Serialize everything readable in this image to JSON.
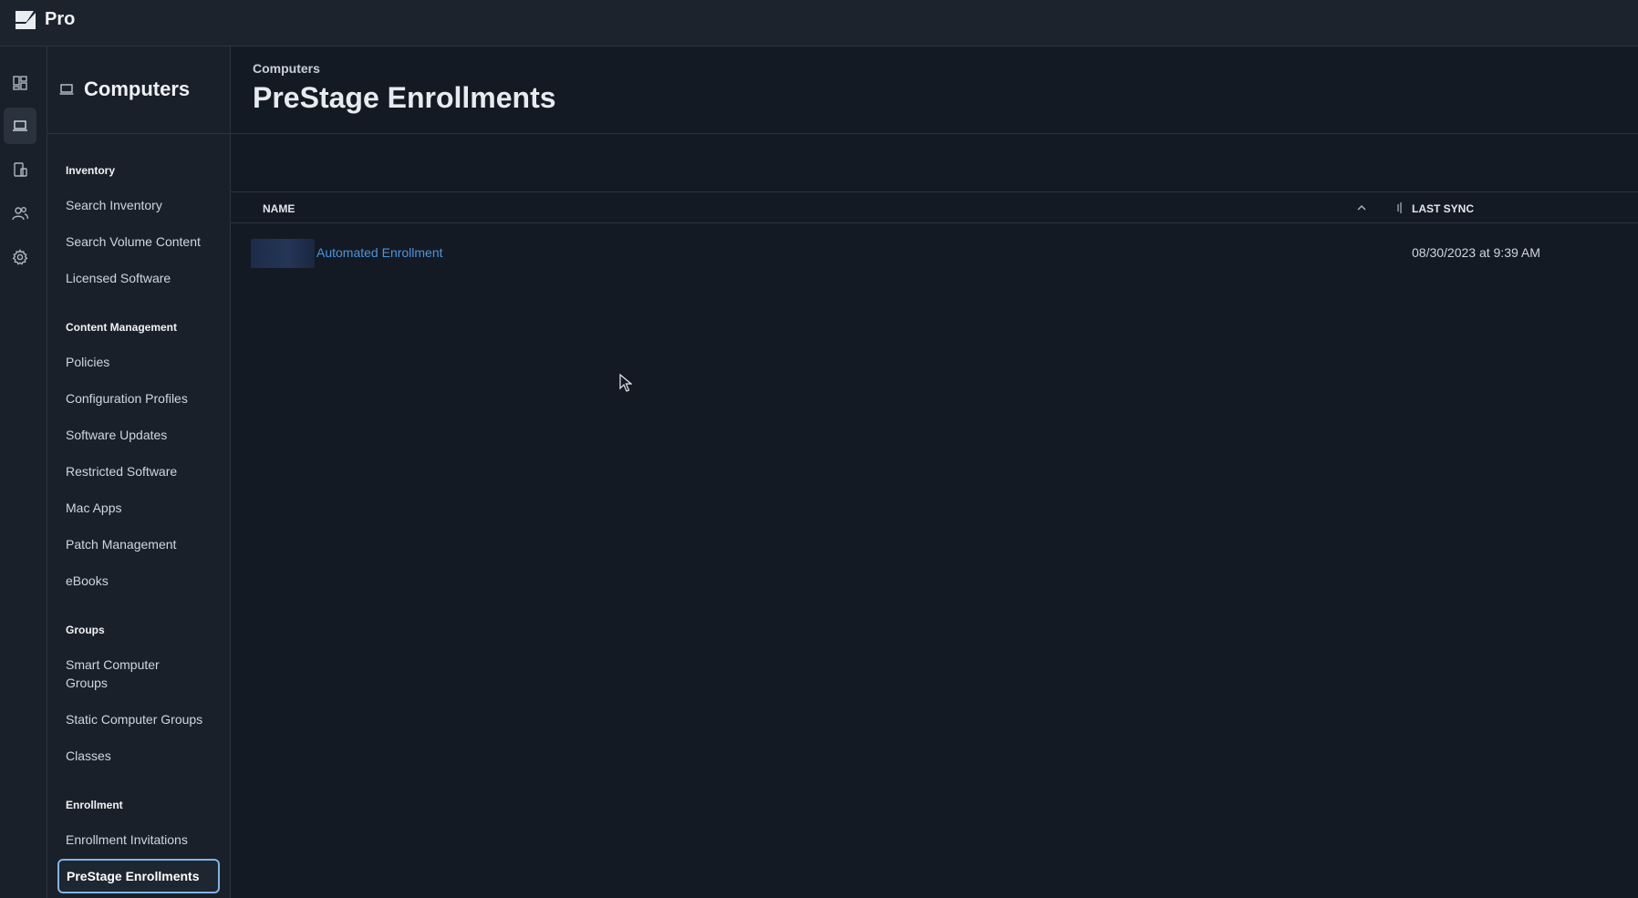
{
  "app": {
    "title": "Pro"
  },
  "rail": {
    "icons": [
      "dashboard-icon",
      "computer-icon",
      "devices-icon",
      "users-icon",
      "settings-icon"
    ],
    "active": "computer-icon"
  },
  "sidebar": {
    "title": "Computers",
    "sections": {
      "inventory": {
        "title": "Inventory",
        "items": [
          "Search Inventory",
          "Search Volume Content",
          "Licensed Software"
        ]
      },
      "content": {
        "title": "Content Management",
        "items": [
          "Policies",
          "Configuration Profiles",
          "Software Updates",
          "Restricted Software",
          "Mac Apps",
          "Patch Management",
          "eBooks"
        ]
      },
      "groups": {
        "title": "Groups",
        "items": [
          "Smart Computer Groups",
          "Static Computer Groups",
          "Classes"
        ]
      },
      "enrollment": {
        "title": "Enrollment",
        "items": [
          "Enrollment Invitations",
          "PreStage Enrollments"
        ]
      }
    }
  },
  "main": {
    "breadcrumb": "Computers",
    "title": "PreStage Enrollments",
    "table": {
      "columns": {
        "name": "NAME",
        "last_sync": "LAST SYNC"
      },
      "rows": [
        {
          "name": "Automated Enrollment",
          "last_sync": "08/30/2023 at 9:39 AM"
        }
      ]
    }
  },
  "colors": {
    "accent": "#4a94e0",
    "background": "#141a23",
    "panel": "#1a2029"
  }
}
